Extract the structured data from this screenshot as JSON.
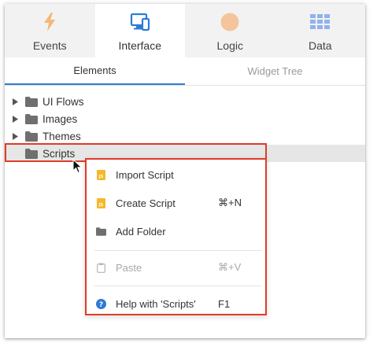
{
  "tabs": [
    {
      "label": "Events",
      "icon": "lightning-icon",
      "active": false
    },
    {
      "label": "Interface",
      "icon": "devices-icon",
      "active": true
    },
    {
      "label": "Logic",
      "icon": "logic-circle-icon",
      "active": false
    },
    {
      "label": "Data",
      "icon": "data-grid-icon",
      "active": false
    }
  ],
  "subtabs": [
    {
      "label": "Elements",
      "active": true
    },
    {
      "label": "Widget Tree",
      "active": false
    }
  ],
  "tree": {
    "items": [
      {
        "label": "UI Flows",
        "expandable": true
      },
      {
        "label": "Images",
        "expandable": true
      },
      {
        "label": "Themes",
        "expandable": true
      },
      {
        "label": "Scripts",
        "expandable": false,
        "selected": true
      }
    ]
  },
  "context_menu": {
    "items": [
      {
        "label": "Import Script",
        "shortcut": "",
        "icon": "js-file-icon",
        "disabled": false
      },
      {
        "label": "Create Script",
        "shortcut": "⌘+N",
        "icon": "js-file-icon",
        "disabled": false
      },
      {
        "label": "Add Folder",
        "shortcut": "",
        "icon": "folder-icon",
        "disabled": false
      },
      {
        "label": "Paste",
        "shortcut": "⌘+V",
        "icon": "clipboard-icon",
        "disabled": true
      },
      {
        "label": "Help with 'Scripts'",
        "shortcut": "F1",
        "icon": "help-icon",
        "disabled": false
      }
    ]
  },
  "colors": {
    "accent": "#2d7ad6",
    "highlight": "#e03c28",
    "events_icon": "#f4b878",
    "logic_icon": "#f4c59a",
    "data_icon": "#8fb3ea",
    "interface_icon": "#2d7ad6",
    "js_icon": "#f6b82a"
  }
}
